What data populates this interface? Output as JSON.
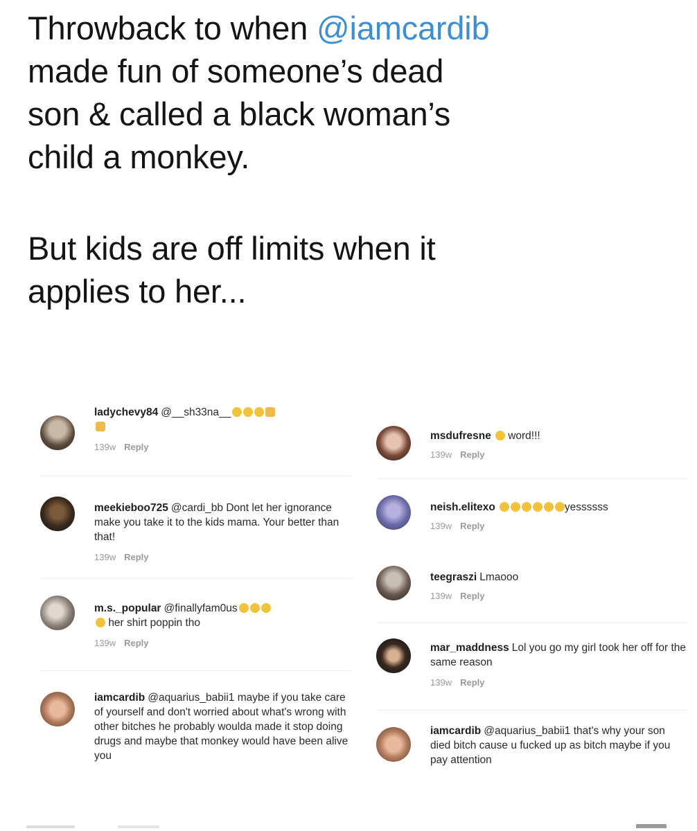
{
  "headline": {
    "line1_prefix": "Throwback to when ",
    "line1_mention": "@iamcardib",
    "line2": "made fun of someone’s dead",
    "line3": "son & called a black woman’s",
    "line4": "child a monkey.",
    "line5": "But kids are off limits when it",
    "line6": "applies to her..."
  },
  "colors": {
    "mention": "#3d8fd1",
    "text": "#141414",
    "meta": "#9a9a9a"
  },
  "left_comments": [
    {
      "username": "ladychevy84",
      "text": "@__sh33na__",
      "emoji_count": 5,
      "time": "139w",
      "reply": "Reply",
      "avatar_icon": "profile-photo"
    },
    {
      "username": "meekieboo725",
      "text": "@cardi_bb Dont let her ignorance make you take it to the kids mama. Your better than that!",
      "time": "139w",
      "reply": "Reply",
      "avatar_icon": "profile-photo"
    },
    {
      "username": "m.s._popular",
      "text": "@finallyfam0us",
      "text2": "her shirt poppin tho",
      "time": "139w",
      "reply": "Reply",
      "avatar_icon": "profile-photo"
    },
    {
      "username": "iamcardib",
      "text": "@aquarius_babii1 maybe if you take care of yourself and don't worried about what's wrong with other bitches he probably woulda made it stop doing drugs and maybe that monkey would have been alive you",
      "avatar_icon": "profile-photo"
    }
  ],
  "right_comments": [
    {
      "username": "msdufresne",
      "text": "word!!!",
      "time": "139w",
      "reply": "Reply",
      "avatar_icon": "profile-photo"
    },
    {
      "username": "neish.elitexo",
      "text": "yessssss",
      "time": "139w",
      "reply": "Reply",
      "avatar_icon": "profile-photo"
    },
    {
      "username": "teegraszi",
      "text": "Lmaooo",
      "time": "139w",
      "reply": "Reply",
      "avatar_icon": "profile-photo"
    },
    {
      "username": "mar_maddness",
      "text": "Lol you go my girl took her off for the same reason",
      "time": "139w",
      "reply": "Reply",
      "avatar_icon": "profile-photo"
    },
    {
      "username": "iamcardib",
      "text": "@aquarius_babii1 that's why your son died bitch cause u fucked up as bitch maybe if you pay attention",
      "avatar_icon": "profile-photo"
    }
  ]
}
